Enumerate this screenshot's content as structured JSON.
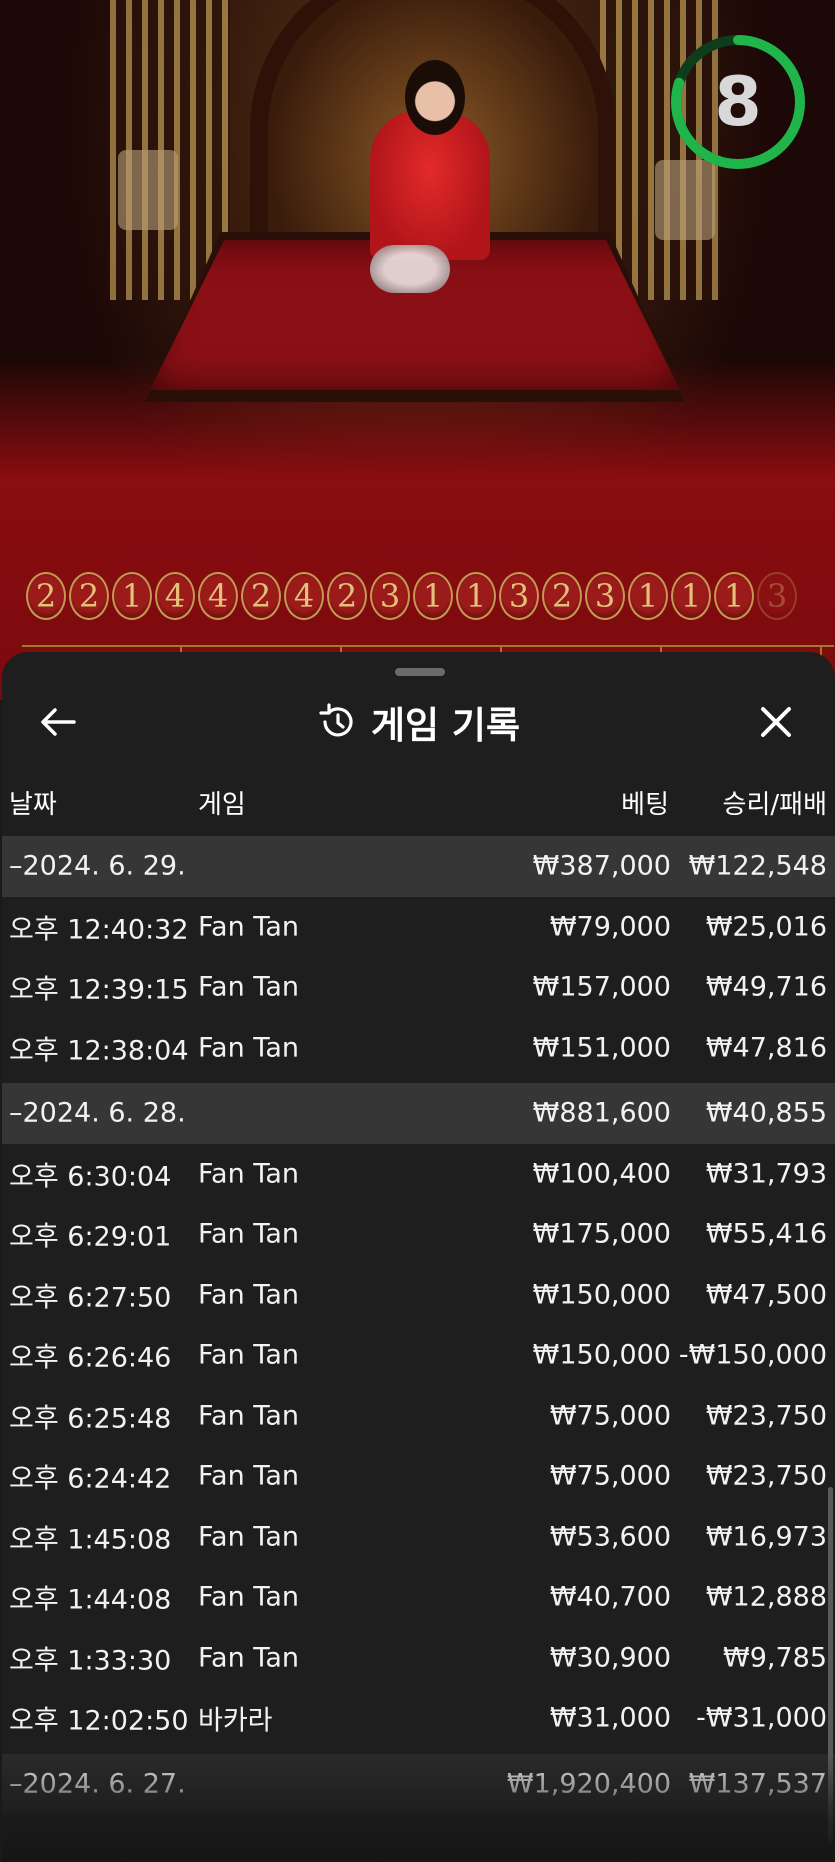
{
  "countdown": {
    "value": "8",
    "fraction": 0.8,
    "color": "#1fb54a"
  },
  "result_history": [
    "2",
    "2",
    "1",
    "4",
    "4",
    "2",
    "4",
    "2",
    "3",
    "1",
    "1",
    "3",
    "2",
    "3",
    "1",
    "1",
    "1",
    "3"
  ],
  "history": {
    "title": "게임 기록",
    "icon": "history-icon",
    "columns": {
      "date": "날짜",
      "game": "게임",
      "bet": "베팅",
      "result": "승리/패배"
    },
    "groups": [
      {
        "date": "–2024. 6. 29.",
        "bet": "₩387,000",
        "result": "₩122,548",
        "rows": [
          {
            "time": "오후 12:40:32",
            "game": "Fan Tan",
            "bet": "₩79,000",
            "result": "₩25,016"
          },
          {
            "time": "오후 12:39:15",
            "game": "Fan Tan",
            "bet": "₩157,000",
            "result": "₩49,716"
          },
          {
            "time": "오후 12:38:04",
            "game": "Fan Tan",
            "bet": "₩151,000",
            "result": "₩47,816"
          }
        ]
      },
      {
        "date": "–2024. 6. 28.",
        "bet": "₩881,600",
        "result": "₩40,855",
        "rows": [
          {
            "time": "오후 6:30:04",
            "game": "Fan Tan",
            "bet": "₩100,400",
            "result": "₩31,793"
          },
          {
            "time": "오후 6:29:01",
            "game": "Fan Tan",
            "bet": "₩175,000",
            "result": "₩55,416"
          },
          {
            "time": "오후 6:27:50",
            "game": "Fan Tan",
            "bet": "₩150,000",
            "result": "₩47,500"
          },
          {
            "time": "오후 6:26:46",
            "game": "Fan Tan",
            "bet": "₩150,000",
            "result": "-₩150,000"
          },
          {
            "time": "오후 6:25:48",
            "game": "Fan Tan",
            "bet": "₩75,000",
            "result": "₩23,750"
          },
          {
            "time": "오후 6:24:42",
            "game": "Fan Tan",
            "bet": "₩75,000",
            "result": "₩23,750"
          },
          {
            "time": "오후 1:45:08",
            "game": "Fan Tan",
            "bet": "₩53,600",
            "result": "₩16,973"
          },
          {
            "time": "오후 1:44:08",
            "game": "Fan Tan",
            "bet": "₩40,700",
            "result": "₩12,888"
          },
          {
            "time": "오후 1:33:30",
            "game": "Fan Tan",
            "bet": "₩30,900",
            "result": "₩9,785"
          },
          {
            "time": "오후 12:02:50",
            "game": "바카라",
            "bet": "₩31,000",
            "result": "-₩31,000"
          }
        ]
      },
      {
        "date": "–2024. 6. 27.",
        "bet": "₩1,920,400",
        "result": "₩137,537",
        "rows": []
      }
    ]
  }
}
